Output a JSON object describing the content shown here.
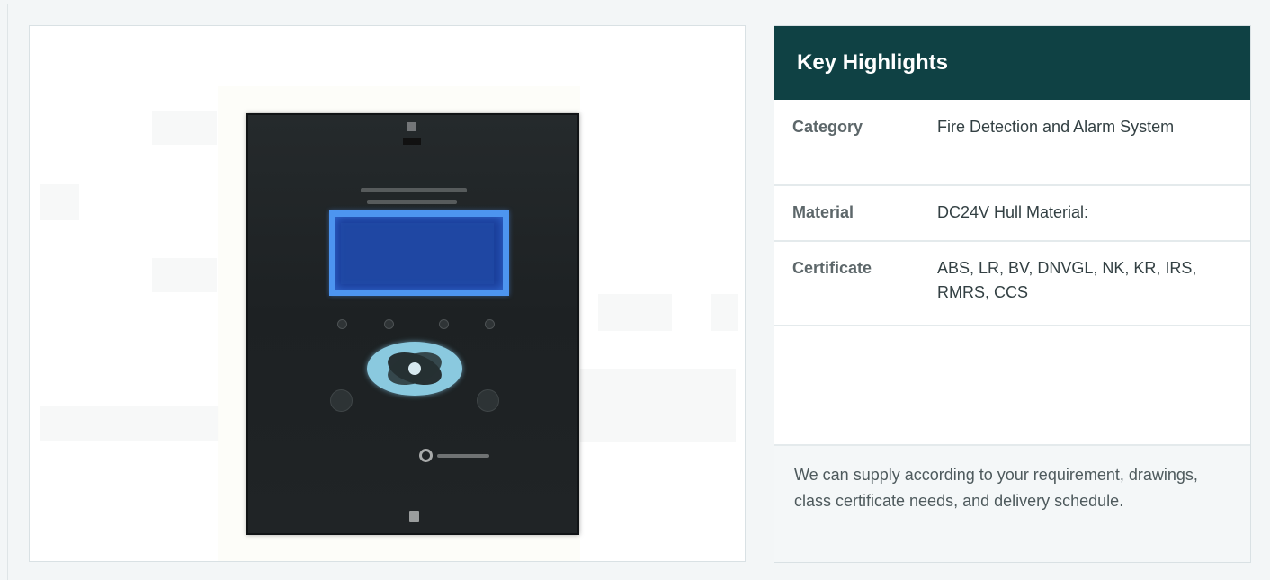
{
  "product_image": {
    "description": "Fire detection and alarm control panel"
  },
  "key_highlights": {
    "title": "Key Highlights",
    "rows": [
      {
        "label": "Category",
        "value": "Fire Detection and Alarm System"
      },
      {
        "label": "Material",
        "value": "DC24V Hull Material:"
      },
      {
        "label": "Certificate",
        "value": "ABS, LR, BV, DNVGL, NK, KR, IRS, RMRS, CCS"
      }
    ],
    "supply_note": "We can supply according to your requirement, drawings, class certificate needs, and delivery schedule."
  },
  "colors": {
    "header_background": "#0f4144",
    "panel_background": "#f3f6f7",
    "label_text": "#5d676a",
    "value_text": "#334043",
    "screen_blue": "#4d95f0"
  }
}
